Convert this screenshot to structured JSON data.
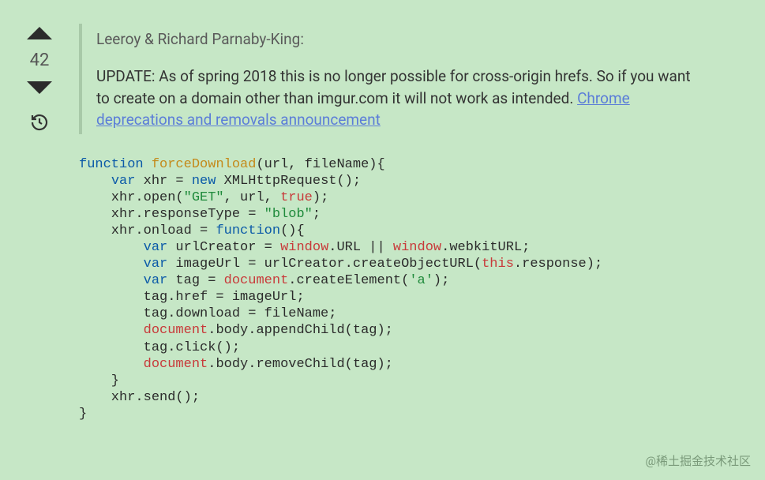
{
  "vote": {
    "count": "42"
  },
  "quote": {
    "author_line": "Leeroy & Richard Parnaby-King:",
    "body_prefix": "UPDATE: As of spring 2018 this is no longer possible for cross-origin hrefs. So if you want to create on a domain other than imgur.com it will not work as intended. ",
    "link_text": "Chrome deprecations and removals announcement"
  },
  "code": {
    "t1": "function",
    "t2": " ",
    "t3": "forceDownload",
    "t4": "(url, fileName){",
    "l2a": "    ",
    "l2b": "var",
    "l2c": " xhr = ",
    "l2d": "new",
    "l2e": " XMLHttpRequest();",
    "l3a": "    xhr.open(",
    "l3b": "\"GET\"",
    "l3c": ", url, ",
    "l3d": "true",
    "l3e": ");",
    "l4a": "    xhr.responseType = ",
    "l4b": "\"blob\"",
    "l4c": ";",
    "l5a": "    xhr.onload = ",
    "l5b": "function",
    "l5c": "(){",
    "l6a": "        ",
    "l6b": "var",
    "l6c": " urlCreator = ",
    "l6d": "window",
    "l6e": ".URL || ",
    "l6f": "window",
    "l6g": ".webkitURL;",
    "l7a": "        ",
    "l7b": "var",
    "l7c": " imageUrl = urlCreator.createObjectURL(",
    "l7d": "this",
    "l7e": ".response);",
    "l8a": "        ",
    "l8b": "var",
    "l8c": " tag = ",
    "l8d": "document",
    "l8e": ".createElement(",
    "l8f": "'a'",
    "l8g": ");",
    "l9": "        tag.href = imageUrl;",
    "l10": "        tag.download = fileName;",
    "l11a": "        ",
    "l11b": "document",
    "l11c": ".body.appendChild(tag);",
    "l12": "        tag.click();",
    "l13a": "        ",
    "l13b": "document",
    "l13c": ".body.removeChild(tag);",
    "l14": "    }",
    "l15": "    xhr.send();",
    "l16": "}"
  },
  "watermark": "@稀土掘金技术社区"
}
